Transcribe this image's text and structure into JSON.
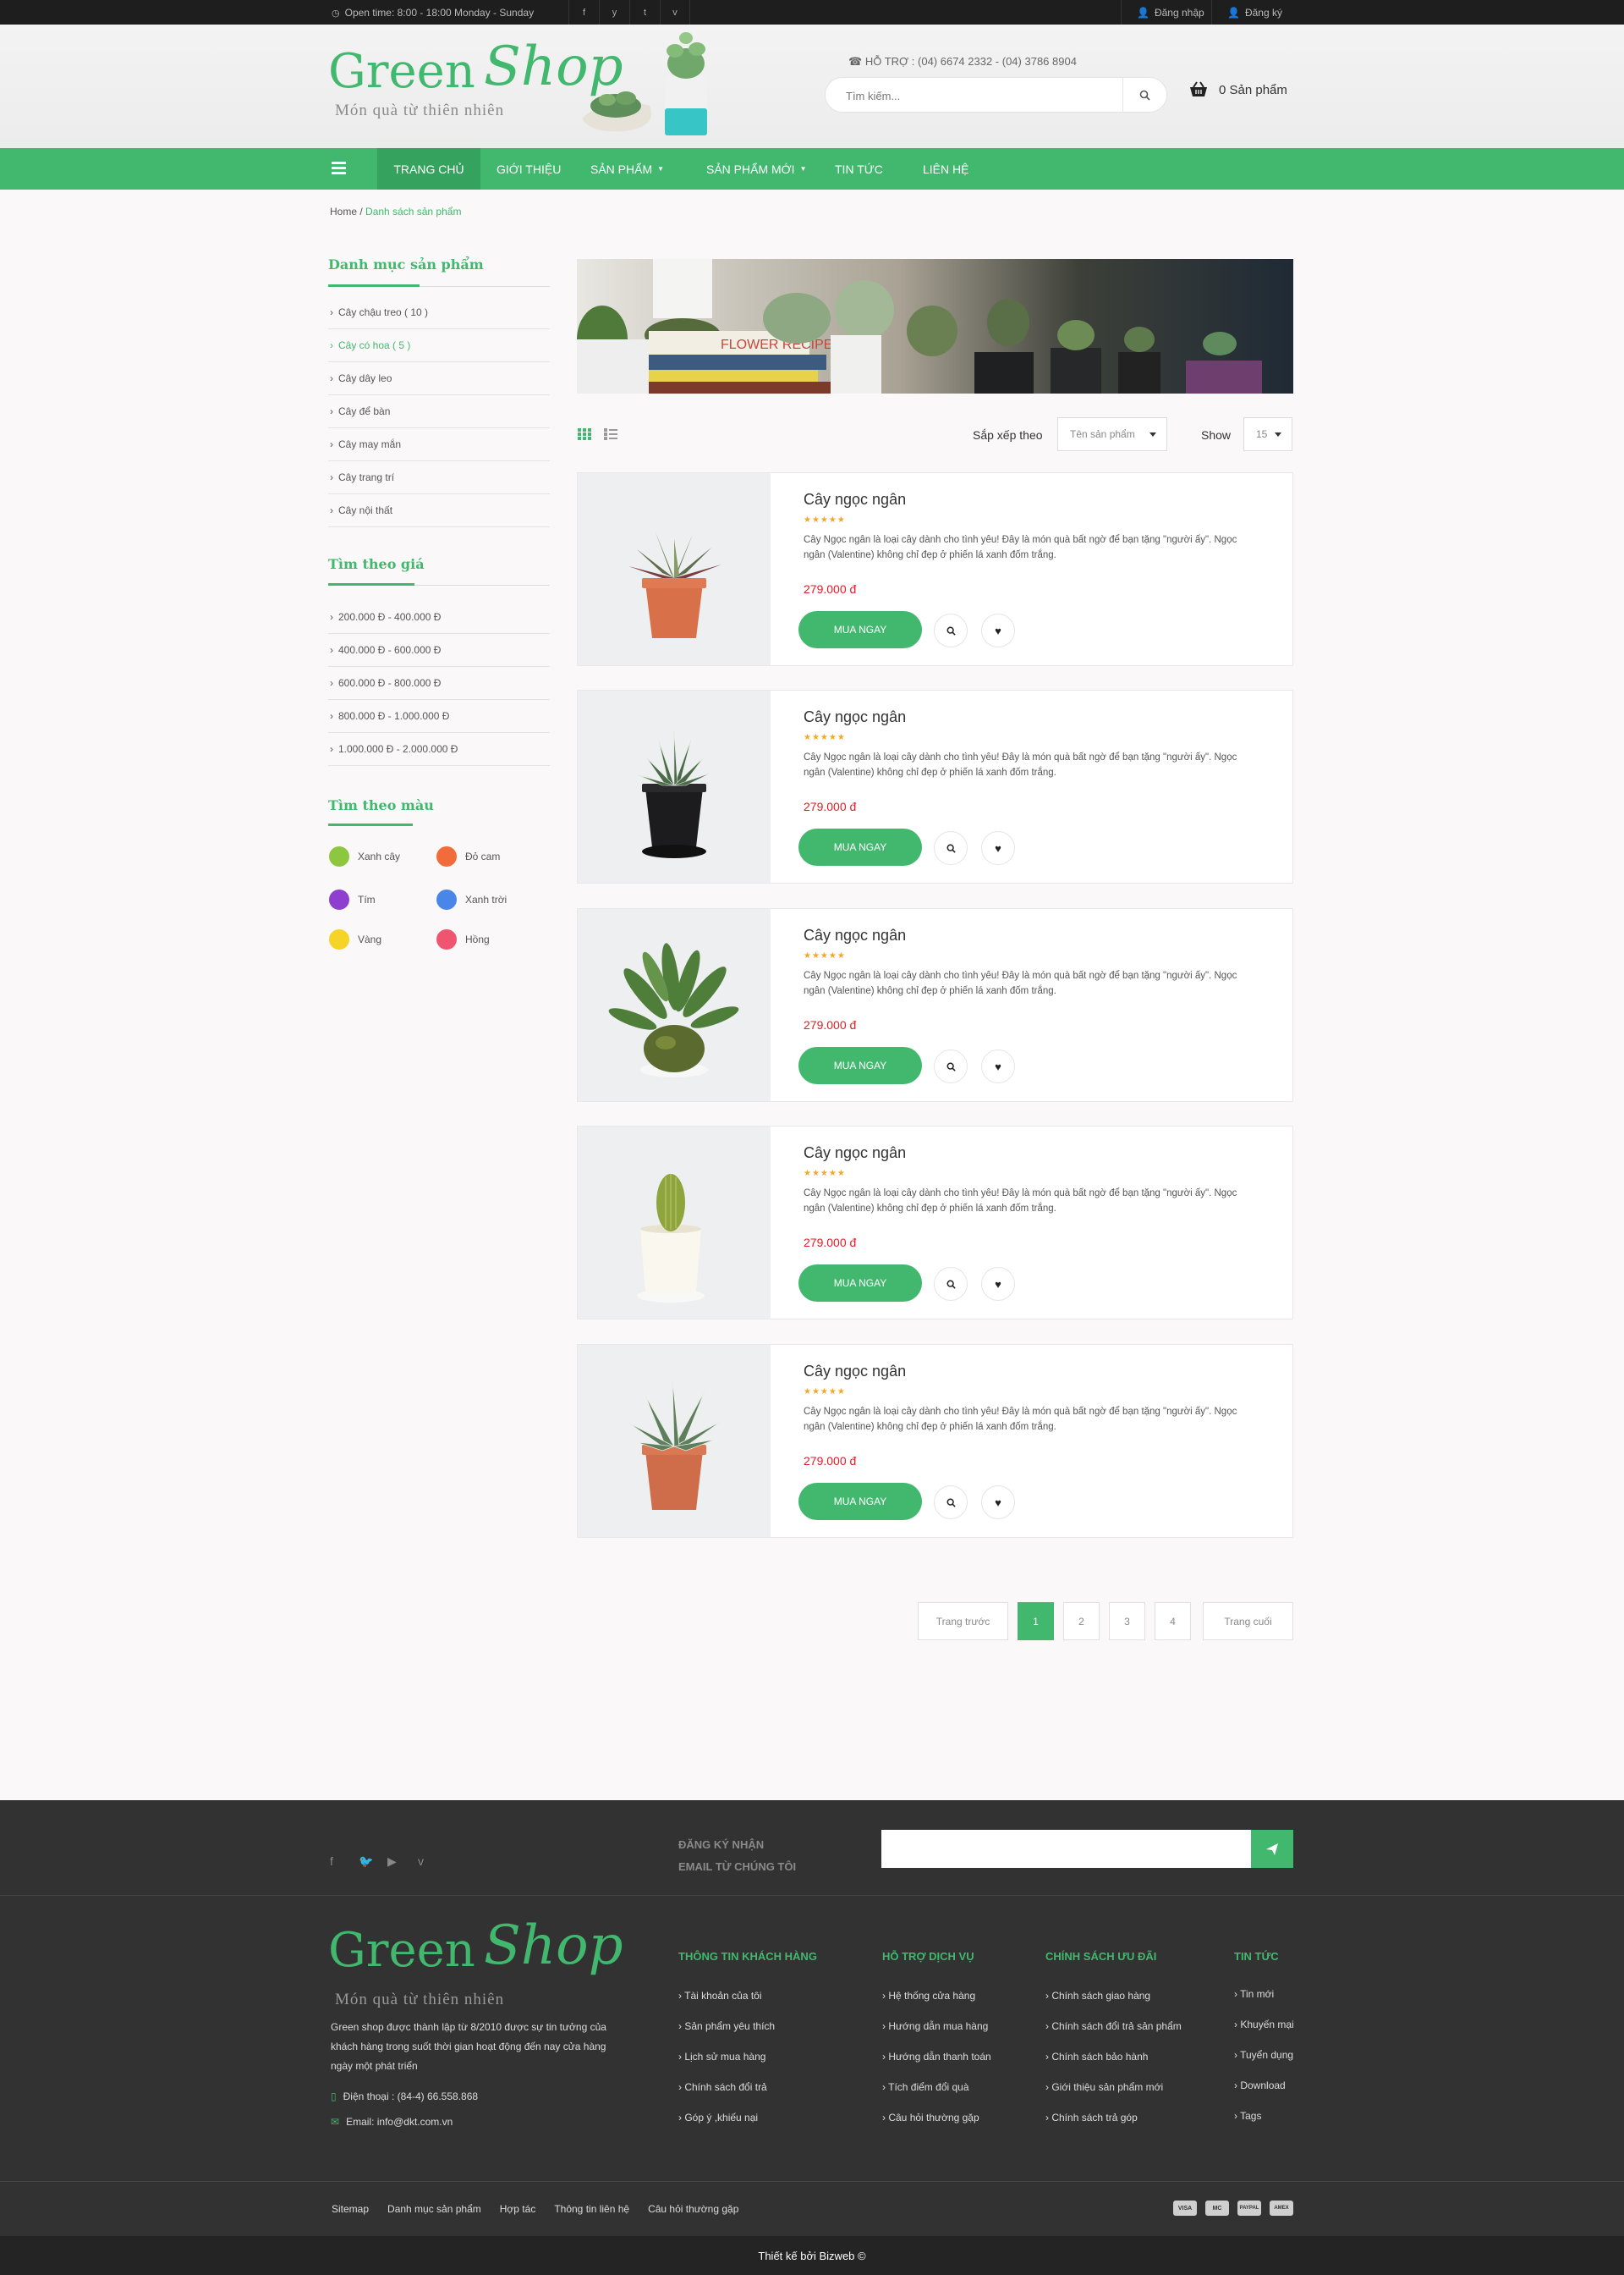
{
  "topbar": {
    "open_time": "Open time: 8:00 - 18:00   Monday - Sunday",
    "social": [
      "f",
      "y",
      "t",
      "v"
    ],
    "login": "Đăng nhập",
    "register": "Đăng ký"
  },
  "header": {
    "logo_main": "Green",
    "logo_script": "Shop",
    "logo_tagline": "Món quà từ thiên nhiên",
    "hotline": "HỖ TRỢ :  (04) 6674 2332 - (04) 3786 8904",
    "search_placeholder": "Tìm kiếm...",
    "cart_label": "0 Sản phẩm"
  },
  "nav": {
    "items": [
      "TRANG CHỦ",
      "GIỚI THIỆU",
      "SẢN PHẨM",
      "SẢN PHẨM MỚI",
      "TIN TỨC",
      "LIÊN HỆ"
    ]
  },
  "breadcrumb": {
    "home": "Home",
    "sep": " / ",
    "current": "Danh sách sản phẩm"
  },
  "sidebar": {
    "categories_title": "Danh mục sản phẩm",
    "categories": [
      "Cây chậu treo ( 10 )",
      "Cây có hoa ( 5 )",
      "Cây dây leo",
      "Cây để bàn",
      "Cây may mắn",
      "Cây trang trí",
      "Cây nội thất"
    ],
    "price_title": "Tìm theo giá",
    "prices": [
      "200.000 Đ - 400.000 Đ",
      "400.000 Đ - 600.000 Đ",
      "600.000 Đ - 800.000 Đ",
      "800.000 Đ - 1.000.000 Đ",
      "1.000.000 Đ - 2.000.000 Đ"
    ],
    "color_title": "Tìm theo màu",
    "colors": [
      {
        "label": "Xanh cây",
        "hex": "#8dc63f"
      },
      {
        "label": "Đỏ cam",
        "hex": "#f26b3a"
      },
      {
        "label": "Tím",
        "hex": "#8e3fd0"
      },
      {
        "label": "Xanh trời",
        "hex": "#4a86e8"
      },
      {
        "label": "Vàng",
        "hex": "#f5d327"
      },
      {
        "label": "Hồng",
        "hex": "#ef5571"
      }
    ]
  },
  "banner": {
    "book_text": "FLOWER RECIPE BOOK"
  },
  "toolbar": {
    "sort_label": "Sắp xếp theo",
    "sort_value": "Tên sản phẩm",
    "show_label": "Show",
    "show_value": "15"
  },
  "products": [
    {
      "name": "Cây ngọc ngân",
      "stars": "★★★★★",
      "desc": "Cây Ngọc ngân là loại cây dành cho tình yêu! Đây là món quà bất ngờ để bạn tặng \"người ấy\". Ngọc ngân (Valentine) không chỉ đẹp ở phiến lá xanh đốm trắng.",
      "price": "279.000 đ",
      "buy": "MUA NGAY"
    },
    {
      "name": "Cây ngọc ngân",
      "stars": "★★★★★",
      "desc": "Cây Ngọc ngân là loại cây dành cho tình yêu! Đây là món quà bất ngờ để bạn tặng \"người ấy\". Ngọc ngân (Valentine) không chỉ đẹp ở phiến lá xanh đốm trắng.",
      "price": "279.000 đ",
      "buy": "MUA NGAY"
    },
    {
      "name": "Cây ngọc ngân",
      "stars": "★★★★★",
      "desc": "Cây Ngọc ngân là loại cây dành cho tình yêu! Đây là món quà bất ngờ để bạn tặng \"người ấy\". Ngọc ngân (Valentine) không chỉ đẹp ở phiến lá xanh đốm trắng.",
      "price": "279.000 đ",
      "buy": "MUA NGAY"
    },
    {
      "name": "Cây ngọc ngân",
      "stars": "★★★★★",
      "desc": "Cây Ngọc ngân là loại cây dành cho tình yêu! Đây là món quà bất ngờ để bạn tặng \"người ấy\". Ngọc ngân (Valentine) không chỉ đẹp ở phiến lá xanh đốm trắng.",
      "price": "279.000 đ",
      "buy": "MUA NGAY"
    },
    {
      "name": "Cây ngọc ngân",
      "stars": "★★★★★",
      "desc": "Cây Ngọc ngân là loại cây dành cho tình yêu! Đây là món quà bất ngờ để bạn tặng \"người ấy\". Ngọc ngân (Valentine) không chỉ đẹp ở phiến lá xanh đốm trắng.",
      "price": "279.000 đ",
      "buy": "MUA NGAY"
    }
  ],
  "pagination": {
    "prev": "Trang trước",
    "pages": [
      "1",
      "2",
      "3",
      "4"
    ],
    "next": "Trang cuối",
    "current": "1"
  },
  "footer": {
    "newsletter_line1": "ĐĂNG KÝ NHẬN",
    "newsletter_line2": "EMAIL TỪ CHÚNG TÔI",
    "newsletter_placeholder": "",
    "about": "Green shop được thành lập từ 8/2010 được sự tin tưởng của khách hàng trong suốt thời gian hoạt động đến nay cửa hàng ngày một phát triển",
    "phone": "Điện thoại : (84-4) 66.558.868",
    "email": "Email: info@dkt.com.vn",
    "col1_title": "THÔNG TIN KHÁCH HÀNG",
    "col1": [
      "Tài khoản của tôi",
      "Sản phẩm yêu thích",
      "Lịch sử mua hàng",
      "Chính sách đổi trả",
      "Góp ý ,khiếu nại"
    ],
    "col2_title": "HỖ TRỢ DỊCH VỤ",
    "col2": [
      "Hệ thống cửa hàng",
      "Hướng dẫn mua hàng",
      "Hướng dẫn thanh toán",
      "Tích điểm đổi quà",
      "Câu hỏi thường gặp"
    ],
    "col3_title": "CHÍNH SÁCH ƯU ĐÃI",
    "col3": [
      "Chính sách giao hàng",
      "Chính sách đổi trả sản phẩm",
      "Chính sách bảo hành",
      "Giới thiệu sản phẩm mới",
      "Chính sách trả góp"
    ],
    "col4_title": "TIN TỨC",
    "col4": [
      "Tin mới",
      "Khuyến mại",
      "Tuyển dụng",
      "Download",
      "Tags"
    ],
    "bottom_links": [
      "Sitemap",
      "Danh mục sản phẩm",
      "Hợp tác",
      "Thông tin liên hệ",
      "Câu hỏi thường gặp"
    ],
    "payments": [
      "VISA",
      "MC",
      "PAYPAL",
      "AMEX"
    ],
    "credit": "Thiết kế  bởi Bizweb ©"
  },
  "colors": {
    "brand_green": "#41b86e",
    "price_red": "#e31b23",
    "star": "#f5a623",
    "footer_bg": "#323232"
  }
}
